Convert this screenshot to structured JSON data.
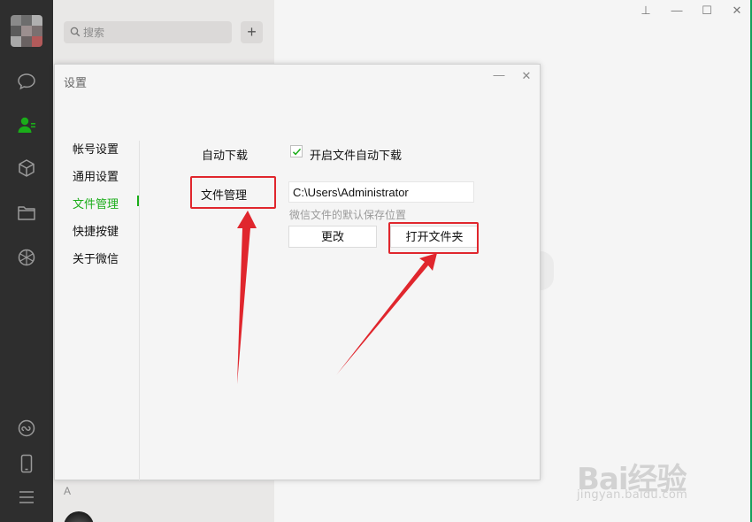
{
  "search": {
    "placeholder": "搜索"
  },
  "add_button": {
    "label": "+"
  },
  "contact_list": {
    "section_letter": "A"
  },
  "window_controls": {
    "pin": "⊥",
    "minimize": "—",
    "maximize": "☐",
    "close": "✕"
  },
  "dialog": {
    "title": "设置",
    "minimize": "—",
    "close": "✕",
    "nav": [
      {
        "label": "帐号设置",
        "active": false
      },
      {
        "label": "通用设置",
        "active": false
      },
      {
        "label": "文件管理",
        "active": true
      },
      {
        "label": "快捷按键",
        "active": false
      },
      {
        "label": "关于微信",
        "active": false
      }
    ],
    "auto_download_label": "自动下载",
    "auto_download_option": "开启文件自动下载",
    "auto_download_checked": true,
    "file_manage_label": "文件管理",
    "path_value": "C:\\Users\\Administrator",
    "path_hint": "微信文件的默认保存位置",
    "change_button": "更改",
    "open_folder_button": "打开文件夹"
  },
  "watermark": {
    "logo": "Bai经验",
    "url": "jingyan.baidu.com"
  },
  "colors": {
    "accent_green": "#1aad19",
    "annotation_red": "#e0262d",
    "rail_dark": "#2e2e2e"
  },
  "icons": [
    "chat-icon",
    "contacts-icon",
    "favorites-cube-icon",
    "folder-icon",
    "moments-icon",
    "mini-program-icon",
    "phone-icon",
    "menu-icon",
    "search-icon",
    "check-icon"
  ]
}
